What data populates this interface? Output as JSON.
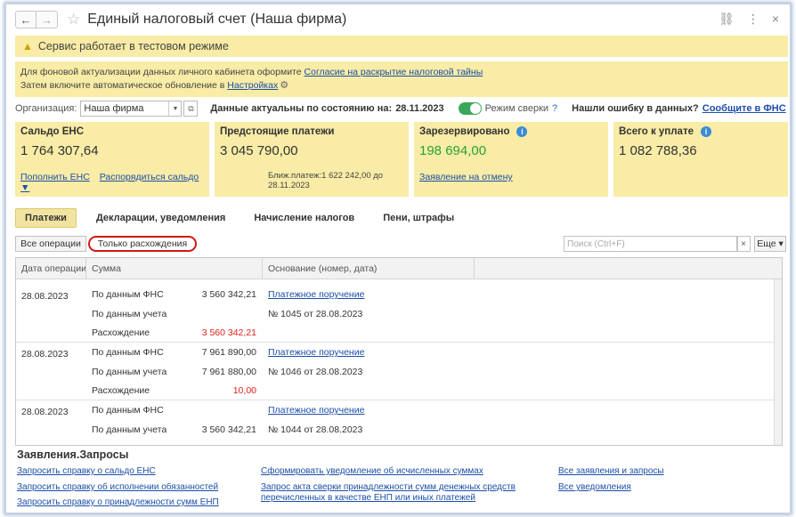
{
  "window": {
    "title": "Единый налоговый счет (Наша фирма)",
    "back_icon": "←",
    "forward_icon": "→",
    "link_icon": "🔗",
    "menu_icon": "⋮",
    "close_icon": "×"
  },
  "warning": {
    "text": "Сервис работает в тестовом режиме"
  },
  "info": {
    "line1_prefix": "Для фоновой актуализации данных личного кабинета оформите",
    "line1_link": "Согласие на раскрытие налоговой тайны",
    "line2_prefix": "Затем включите автоматическое обновление в",
    "line2_link": "Настройках"
  },
  "org_row": {
    "org_label": "Организация:",
    "org_value": "Наша фирма",
    "actual_label": "Данные актуальны по состоянию на:",
    "actual_date": "28.11.2023",
    "reconcile_label": "Режим сверки",
    "reconcile_help": "?",
    "error_label": "Нашли ошибку в данных?",
    "report_link": "Сообщите в ФНС"
  },
  "cards": {
    "balance": {
      "title": "Сальдо ЕНС",
      "value": "1 764 307,64",
      "link1": "Пополнить ЕНС",
      "link2": "Распорядиться сальдо ▼"
    },
    "upcoming": {
      "title": "Предстоящие платежи",
      "value": "3 045 790,00",
      "note": "Ближ.платеж:1 622 242,00 до 28.11.2023"
    },
    "reserved": {
      "title": "Зарезервировано",
      "value": "198 694,00",
      "link": "Заявление на отмену"
    },
    "total": {
      "title": "Всего к уплате",
      "value": "1 082 788,36"
    }
  },
  "tabs": [
    "Платежи",
    "Декларации, уведомления",
    "Начисление налогов",
    "Пени, штрафы"
  ],
  "filters": {
    "all_ops": "Все операции",
    "only_diff": "Только расхождения",
    "search_placeholder": "Поиск (Ctrl+F)",
    "clear": "×",
    "more": "Еще ▾"
  },
  "table": {
    "columns": [
      "Дата операции",
      "Сумма",
      "Основание (номер, дата)"
    ],
    "rows": [
      {
        "date": "28.08.2023",
        "lines": [
          {
            "label": "По данным ФНС",
            "amount": "3 560 342,21",
            "basis": "Платежное поручение",
            "basis_link": true
          },
          {
            "label": "По данным учета",
            "amount": "",
            "basis": "№ 1045 от 28.08.2023",
            "basis_link": false
          },
          {
            "label": "Расхождение",
            "amount": "3 560 342,21",
            "basis": "",
            "basis_link": false,
            "red": true
          }
        ]
      },
      {
        "date": "28.08.2023",
        "lines": [
          {
            "label": "По данным ФНС",
            "amount": "7 961 890,00",
            "basis": "Платежное поручение",
            "basis_link": true
          },
          {
            "label": "По данным учета",
            "amount": "7 961 880,00",
            "basis": "№ 1046 от 28.08.2023",
            "basis_link": false
          },
          {
            "label": "Расхождение",
            "amount": "10,00",
            "basis": "",
            "basis_link": false,
            "red": true
          }
        ]
      },
      {
        "date": "28.08.2023",
        "lines": [
          {
            "label": "По данным ФНС",
            "amount": "",
            "basis": "Платежное поручение",
            "basis_link": true
          },
          {
            "label": "По данным учета",
            "amount": "3 560 342,21",
            "basis": "№ 1044 от 28.08.2023",
            "basis_link": false
          }
        ]
      }
    ]
  },
  "requests": {
    "title": "Заявления.Запросы",
    "col1": [
      "Запросить справку о сальдо ЕНС",
      "Запросить справку об исполнении обязанностей",
      "Запросить справку о принадлежности сумм ЕНП"
    ],
    "col2_a": "Сформировать уведомление об исчисленных суммах",
    "col2_b1": "Запрос акта сверки принадлежности сумм денежных средств",
    "col2_b2": "перечисленных в качестве ЕНП или иных платежей",
    "col3": [
      "Все заявления и запросы",
      "Все уведомления"
    ]
  }
}
